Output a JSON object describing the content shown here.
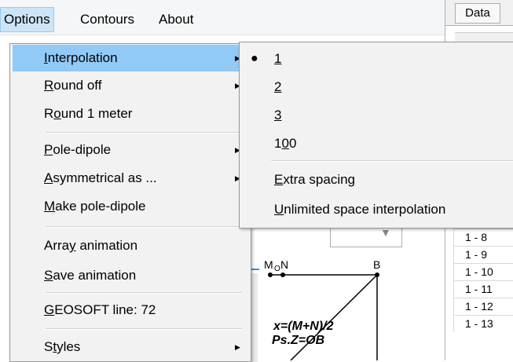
{
  "menubar": {
    "items": [
      "Options",
      "Contours",
      "About"
    ]
  },
  "data_panel": {
    "tab_label": "Data",
    "rows": [
      "1 - 8",
      "1 - 9",
      "1 - 10",
      "1 - 11",
      "1 - 12",
      "1 - 13"
    ]
  },
  "diagram": {
    "label_m": "M",
    "label_o": "O",
    "label_n": "N",
    "label_b": "B",
    "formula_1": "x=(M+N)/2",
    "formula_2": "Ps.Z=OB"
  },
  "options_menu": {
    "items": [
      {
        "pre": "",
        "u": "I",
        "post": "nterpolation",
        "has_submenu": true,
        "highlighted": true
      },
      {
        "pre": "",
        "u": "R",
        "post": "ound off",
        "has_submenu": true
      },
      {
        "pre": "R",
        "u": "o",
        "post": "und 1 meter",
        "has_submenu": false
      },
      {
        "pre": "",
        "u": "P",
        "post": "ole-dipole",
        "has_submenu": true
      },
      {
        "pre": "",
        "u": "A",
        "post": "symmetrical as ...",
        "has_submenu": true
      },
      {
        "pre": "",
        "u": "M",
        "post": "ake pole-dipole",
        "has_submenu": false
      },
      {
        "pre": "Arra",
        "u": "y",
        "post": " animation",
        "has_submenu": false
      },
      {
        "pre": "",
        "u": "S",
        "post": "ave animation",
        "has_submenu": false
      },
      {
        "pre": "",
        "u": "G",
        "post": "EOSOFT line: 72",
        "has_submenu": false
      },
      {
        "pre": "S",
        "u": "t",
        "post": "yles",
        "has_submenu": true
      }
    ]
  },
  "interpolation_submenu": {
    "items": [
      {
        "pre": "",
        "u": "1",
        "post": "",
        "checked": true
      },
      {
        "pre": "",
        "u": "2",
        "post": "",
        "checked": false
      },
      {
        "pre": "",
        "u": "3",
        "post": "",
        "checked": false
      },
      {
        "pre": "1",
        "u": "0",
        "post": "0",
        "checked": false
      },
      {
        "pre": "",
        "u": "E",
        "post": "xtra spacing",
        "checked": false
      },
      {
        "pre": "",
        "u": "U",
        "post": "nlimited space interpolation",
        "checked": false
      }
    ]
  },
  "colors": {
    "highlight": "#91c9f7",
    "menu_bg": "#f2f2f2",
    "active_menubar": "#cce4f7"
  },
  "icons": {
    "submenu_arrow": "triangle-right-icon",
    "radio_bullet": "bullet-icon"
  }
}
